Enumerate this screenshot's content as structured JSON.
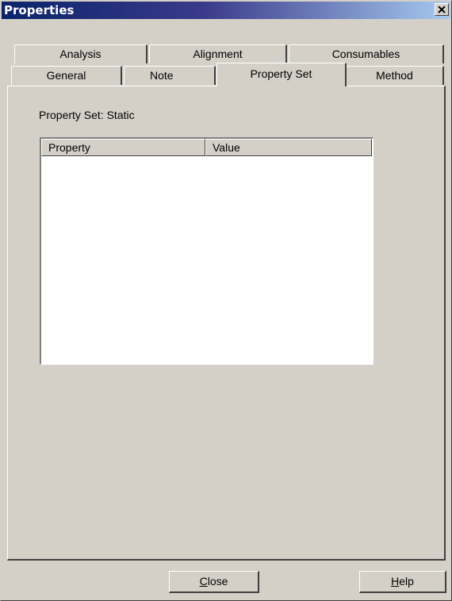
{
  "window": {
    "title": "Properties"
  },
  "tabs": {
    "row_back": [
      {
        "label": "Analysis"
      },
      {
        "label": "Alignment"
      },
      {
        "label": "Consumables"
      }
    ],
    "row_front": [
      {
        "label": "General"
      },
      {
        "label": "Note"
      },
      {
        "label": "Property Set",
        "selected": true
      },
      {
        "label": "Method"
      }
    ]
  },
  "property_set": {
    "label": "Property Set:",
    "value": "Static"
  },
  "list": {
    "columns": [
      "Property",
      "Value"
    ],
    "rows": []
  },
  "buttons": {
    "close": {
      "mnemonic": "C",
      "rest": "lose"
    },
    "help": {
      "mnemonic": "H",
      "rest": "elp"
    }
  },
  "icons": {
    "close": "close-icon"
  },
  "colors": {
    "dialog_face": "#d4d0c8",
    "title_start": "#0a246a",
    "title_end": "#a6caf0"
  }
}
